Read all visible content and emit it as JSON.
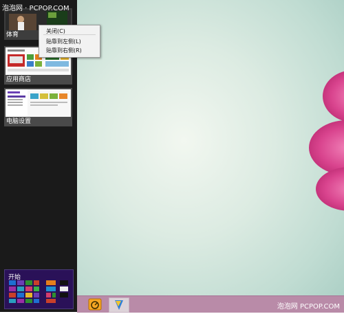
{
  "watermark": {
    "top_left": "泡泡网 · PCPOP.COM",
    "bottom_right": "泡泡网  PCPOP.COM"
  },
  "switcher": {
    "apps": [
      {
        "label": "体育"
      },
      {
        "label": "应用商店"
      },
      {
        "label": "电脑设置"
      }
    ],
    "start_tile": {
      "label": "开始"
    }
  },
  "context_menu": {
    "items": [
      {
        "label": "关闭(C)"
      },
      {
        "label": "贴靠到左侧(L)"
      },
      {
        "label": "贴靠到右侧(R)"
      }
    ]
  },
  "taskbar": {
    "buttons": [
      {
        "icon": "internet-explorer-icon"
      },
      {
        "icon": "file-explorer-icon"
      }
    ]
  },
  "colors": {
    "switcher_bg": "#1a1a1a",
    "taskbar_bg": "#b98ba8",
    "start_tile_bg": "#2a1158",
    "flower": "#d9448e"
  }
}
